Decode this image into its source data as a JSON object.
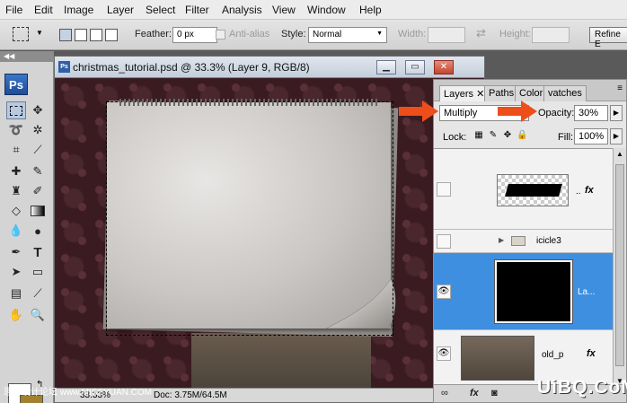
{
  "menu": [
    "File",
    "Edit",
    "Image",
    "Layer",
    "Select",
    "Filter",
    "Analysis",
    "View",
    "Window",
    "Help"
  ],
  "options": {
    "feather_label": "Feather:",
    "feather_value": "0 px",
    "antialias_label": "Anti-alias",
    "style_label": "Style:",
    "style_value": "Normal",
    "width_label": "Width:",
    "height_label": "Height:",
    "refine_label": "Refine E"
  },
  "tools": {
    "logo": "Ps",
    "icons": [
      "marquee-icon",
      "move-icon",
      "lasso-icon",
      "magic-wand-icon",
      "crop-icon",
      "eyedropper-icon",
      "spot-heal-icon",
      "brush-icon",
      "clone-stamp-icon",
      "history-brush-icon",
      "eraser-icon",
      "gradient-icon",
      "blur-icon",
      "dodge-icon",
      "pen-icon",
      "type-icon",
      "path-select-icon",
      "shape-icon",
      "notes-icon",
      "eyedropper2-icon",
      "hand-icon",
      "zoom-icon"
    ],
    "fg_color": "#ffffff",
    "bg_color": "#a0812f"
  },
  "document": {
    "title": "christmas_tutorial.psd @ 33.3% (Layer 9, RGB/8)",
    "zoom": "33.33%",
    "doc_info": "Doc: 3.75M/64.5M"
  },
  "layers_panel": {
    "tabs": [
      "Layers",
      "Paths",
      "Color",
      "vatches"
    ],
    "blend_mode": "Multiply",
    "opacity_label": "Opacity:",
    "opacity_value": "30%",
    "lock_label": "Lock:",
    "fill_label": "Fill:",
    "fill_value": "100%",
    "layers": [
      {
        "name": "..",
        "fx": "fx",
        "visible": false,
        "selected": false
      },
      {
        "name": "icicle3",
        "visible": false,
        "selected": false
      },
      {
        "name": "La...",
        "visible": true,
        "selected": true
      },
      {
        "name": "old_p",
        "fx": "fx",
        "visible": true,
        "selected": false
      }
    ]
  },
  "annotations": {
    "footer_cn": "思缘设计论坛 www.MISSYUAN.COM",
    "watermark": "UiBQ.CoM"
  }
}
